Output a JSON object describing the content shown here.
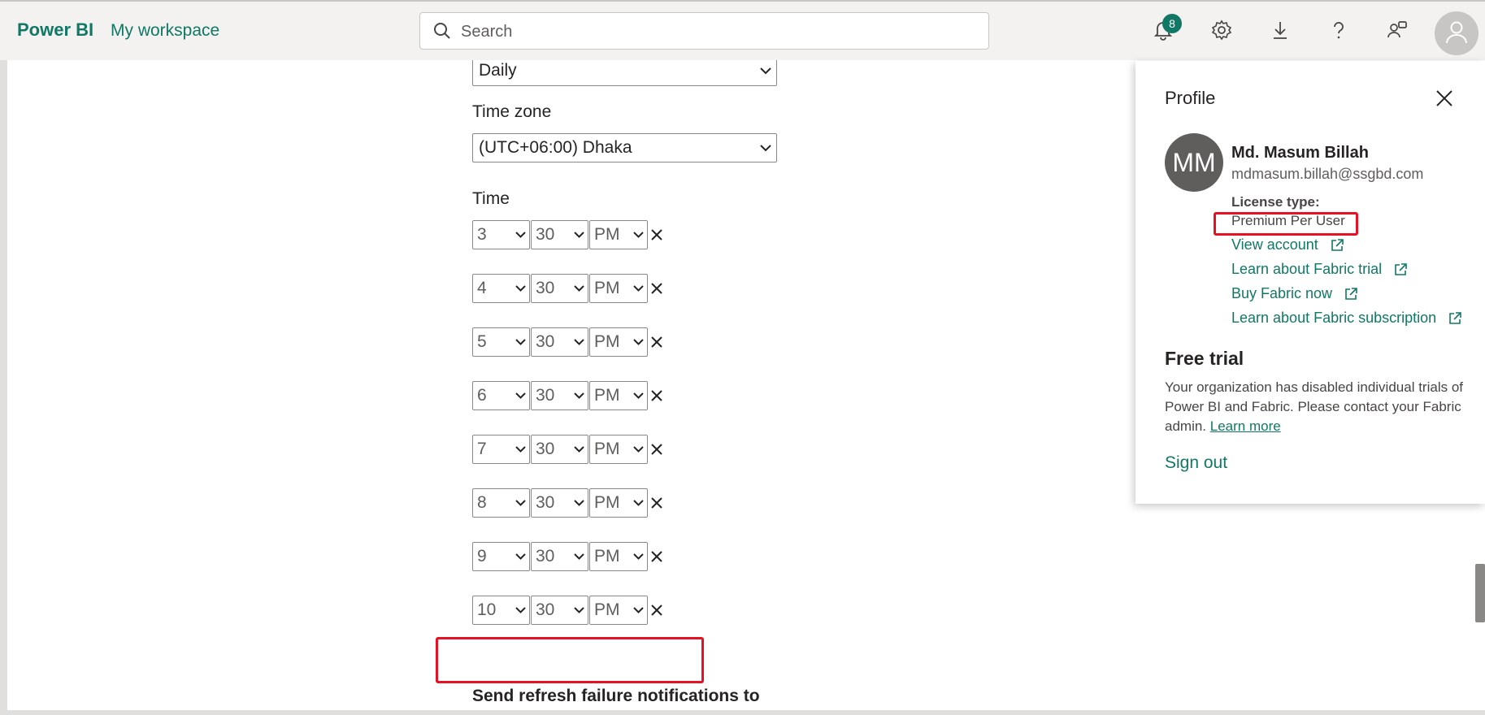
{
  "header": {
    "brand": "Power BI",
    "workspace": "My workspace",
    "search_placeholder": "Search",
    "notification_count": "8"
  },
  "form": {
    "frequency_value": "Daily",
    "timezone_label": "Time zone",
    "timezone_value": "(UTC+06:00) Dhaka",
    "time_label": "Time",
    "times": [
      {
        "hour": "3",
        "minute": "30",
        "ampm": "PM"
      },
      {
        "hour": "4",
        "minute": "30",
        "ampm": "PM"
      },
      {
        "hour": "5",
        "minute": "30",
        "ampm": "PM"
      },
      {
        "hour": "6",
        "minute": "30",
        "ampm": "PM"
      },
      {
        "hour": "7",
        "minute": "30",
        "ampm": "PM"
      },
      {
        "hour": "8",
        "minute": "30",
        "ampm": "PM"
      },
      {
        "hour": "9",
        "minute": "30",
        "ampm": "PM"
      },
      {
        "hour": "10",
        "minute": "30",
        "ampm": "PM"
      }
    ],
    "notify_label": "Send refresh failure notifications to"
  },
  "profile": {
    "title": "Profile",
    "initials": "MM",
    "name": "Md. Masum Billah",
    "email": "mdmasum.billah@ssgbd.com",
    "license_label": "License type:",
    "license_value": "Premium Per User",
    "links": [
      "View account",
      "Learn about Fabric trial",
      "Buy Fabric now",
      "Learn about Fabric subscription"
    ],
    "free_trial_title": "Free trial",
    "free_trial_text": "Your organization has disabled individual trials of Power BI and Fabric. Please contact your Fabric admin.",
    "learn_more": "Learn more",
    "sign_out": "Sign out"
  },
  "colors": {
    "accent": "#117865",
    "highlight": "#e81123"
  }
}
